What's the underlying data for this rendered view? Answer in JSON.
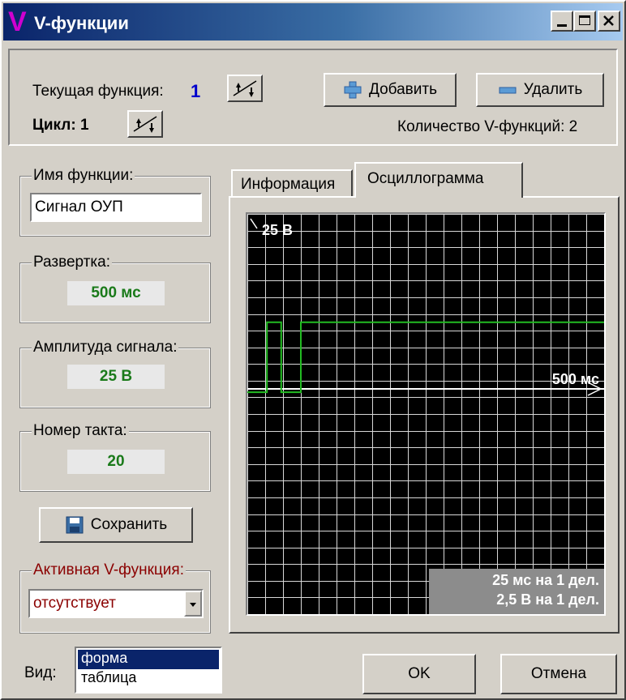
{
  "window": {
    "title": "V-функции",
    "logo": "V",
    "controls": [
      "minimize-icon",
      "maximize-icon",
      "close-icon"
    ]
  },
  "header": {
    "current_label": "Текущая функция:",
    "current_value": "1",
    "cycle_label": "Цикл: 1",
    "add_label": "Добавить",
    "delete_label": "Удалить",
    "count_label": "Количество V-функций: 2"
  },
  "left": {
    "name_label": "Имя функции:",
    "name_value": "Сигнал ОУП",
    "sweep_label": "Развертка:",
    "sweep_value": "500 мс",
    "amp_label": "Амплитуда сигнала:",
    "amp_value": "25 В",
    "tact_label": "Номер такта:",
    "tact_value": "20",
    "save_label": "Сохранить",
    "active_label": "Активная V-функция:",
    "active_value": "отсутствует"
  },
  "tabs": [
    {
      "label": "Информация",
      "active": false
    },
    {
      "label": "Осциллограмма",
      "active": true
    }
  ],
  "scope": {
    "y_label": "25 В",
    "x_label": "500 мс",
    "scale_time": "25 мс на 1 дел.",
    "scale_volt": "2,5 В на 1 дел.",
    "signal_color": "#22bb22"
  },
  "chart_data": {
    "type": "line",
    "title": "",
    "xlabel": "500 мс",
    "ylabel": "25 В",
    "x_divisions": 20,
    "y_divisions": 24,
    "x_per_div": "25 мс",
    "y_per_div": "2,5 В",
    "series": [
      {
        "color": "#22bb22",
        "x": [
          0,
          27.5,
          27.5,
          47.5,
          47.5,
          75,
          75,
          500
        ],
        "y": [
          -0.5,
          -0.5,
          10,
          10,
          -0.5,
          -0.5,
          10,
          10
        ]
      }
    ]
  },
  "footer": {
    "view_label": "Вид:",
    "view_options": [
      "форма",
      "таблица"
    ],
    "view_selected": "форма",
    "ok_label": "OK",
    "cancel_label": "Отмена"
  },
  "colors": {
    "title_start": "#0a246a",
    "title_end": "#a6caf0",
    "accent_blue": "#0000cc",
    "value_green": "#1a7a1a",
    "active_red": "#8b0000",
    "scope_bg": "#000000"
  }
}
